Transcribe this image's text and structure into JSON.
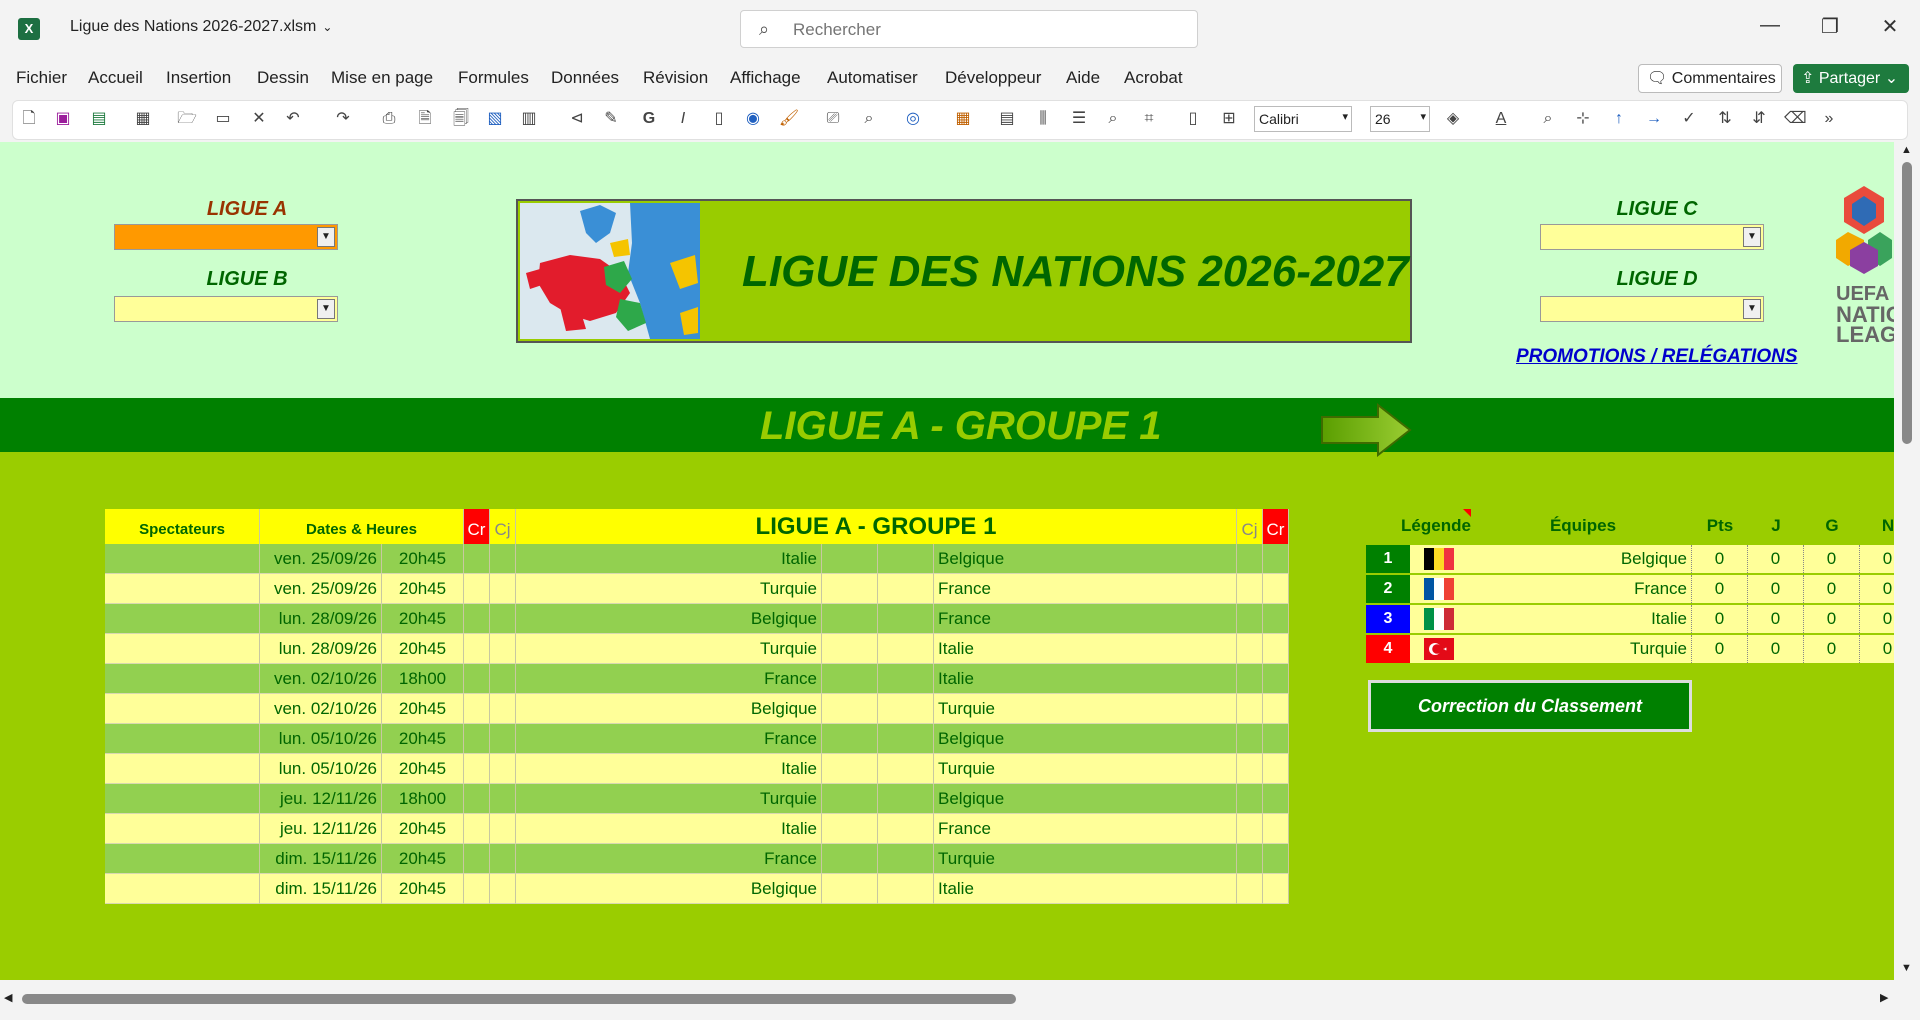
{
  "window": {
    "title": "Ligue des Nations 2026-2027.xlsm",
    "search_placeholder": "Rechercher"
  },
  "menu": [
    "Fichier",
    "Accueil",
    "Insertion",
    "Dessin",
    "Mise en page",
    "Formules",
    "Données",
    "Révision",
    "Affichage",
    "Automatiser",
    "Développeur",
    "Aide",
    "Acrobat"
  ],
  "actions": {
    "comments": "Commentaires",
    "share": "Partager"
  },
  "toolbar": {
    "font": "Calibri",
    "size": "26"
  },
  "sheet": {
    "leagues": {
      "a": "LIGUE A",
      "b": "LIGUE B",
      "c": "LIGUE C",
      "d": "LIGUE D"
    },
    "banner_title": "LIGUE DES NATIONS 2026-2027",
    "promo_link": "PROMOTIONS / RELÉGATIONS",
    "logo_text": [
      "UEFA",
      "NATIO",
      "LEAG"
    ],
    "group_title": "LIGUE A - GROUPE 1",
    "matches_header": {
      "spectators": "Spectateurs",
      "dates": "Dates & Heures",
      "cr": "Cr",
      "cj": "Cj",
      "title": "LIGUE A - GROUPE 1"
    },
    "matches": [
      {
        "date": "ven. 25/09/26",
        "time": "20h45",
        "home": "Italie",
        "away": "Belgique"
      },
      {
        "date": "ven. 25/09/26",
        "time": "20h45",
        "home": "Turquie",
        "away": "France"
      },
      {
        "date": "lun. 28/09/26",
        "time": "20h45",
        "home": "Belgique",
        "away": "France"
      },
      {
        "date": "lun. 28/09/26",
        "time": "20h45",
        "home": "Turquie",
        "away": "Italie"
      },
      {
        "date": "ven. 02/10/26",
        "time": "18h00",
        "home": "France",
        "away": "Italie"
      },
      {
        "date": "ven. 02/10/26",
        "time": "20h45",
        "home": "Belgique",
        "away": "Turquie"
      },
      {
        "date": "lun. 05/10/26",
        "time": "20h45",
        "home": "France",
        "away": "Belgique"
      },
      {
        "date": "lun. 05/10/26",
        "time": "20h45",
        "home": "Italie",
        "away": "Turquie"
      },
      {
        "date": "jeu. 12/11/26",
        "time": "18h00",
        "home": "Turquie",
        "away": "Belgique"
      },
      {
        "date": "jeu. 12/11/26",
        "time": "20h45",
        "home": "Italie",
        "away": "France"
      },
      {
        "date": "dim. 15/11/26",
        "time": "20h45",
        "home": "France",
        "away": "Turquie"
      },
      {
        "date": "dim. 15/11/26",
        "time": "20h45",
        "home": "Belgique",
        "away": "Italie"
      }
    ],
    "standings_header": {
      "legend": "Légende",
      "teams": "Équipes",
      "pts": "Pts",
      "j": "J",
      "g": "G",
      "n": "N"
    },
    "standings": [
      {
        "rank": "1",
        "team": "Belgique",
        "pts": "0",
        "j": "0",
        "g": "0",
        "n": "0",
        "color": "#008000",
        "flag": "belgium"
      },
      {
        "rank": "2",
        "team": "France",
        "pts": "0",
        "j": "0",
        "g": "0",
        "n": "0",
        "color": "#008000",
        "flag": "france"
      },
      {
        "rank": "3",
        "team": "Italie",
        "pts": "0",
        "j": "0",
        "g": "0",
        "n": "0",
        "color": "#0000ff",
        "flag": "italy"
      },
      {
        "rank": "4",
        "team": "Turquie",
        "pts": "0",
        "j": "0",
        "g": "0",
        "n": "0",
        "color": "#ff0000",
        "flag": "turkey"
      }
    ],
    "correct_button": "Correction du Classement"
  },
  "colors": {
    "sheet_green": "#9acd00",
    "band_light": "#ccffcc",
    "dark_green": "#008000",
    "header_yellow": "#ffff00",
    "row_green": "#92d050",
    "row_yellow": "#ffff99",
    "league_a_label": "#993300",
    "league_label": "#006600",
    "league_a_select": "#ff9900",
    "league_select": "#ffff99"
  }
}
